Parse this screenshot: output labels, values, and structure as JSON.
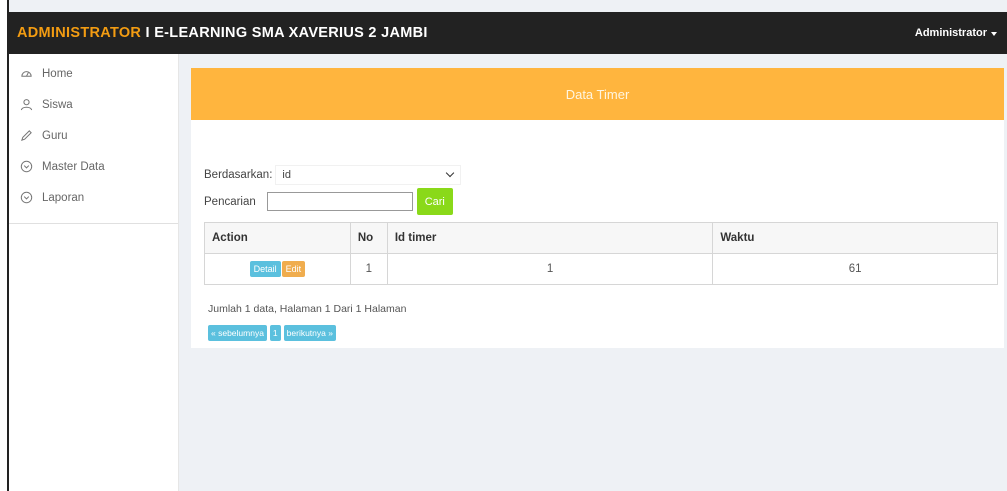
{
  "topbar": {
    "brand_part1": "ADMINISTRATOR",
    "brand_part2": " I E-LEARNING SMA XAVERIUS 2 JAMBI",
    "user_label": "Administrator"
  },
  "sidebar": {
    "items": [
      {
        "label": "Home",
        "icon": "dashboard-icon"
      },
      {
        "label": "Siswa",
        "icon": "user-icon"
      },
      {
        "label": "Guru",
        "icon": "pencil-icon"
      },
      {
        "label": "Master Data",
        "icon": "circle-chevron-down-icon"
      },
      {
        "label": "Laporan",
        "icon": "circle-chevron-down-icon"
      }
    ]
  },
  "panel": {
    "title": "Data Timer"
  },
  "filter": {
    "by_label": "Berdasarkan:",
    "by_value": "id",
    "search_label": "Pencarian",
    "search_value": "",
    "search_button": "Cari"
  },
  "table": {
    "headers": [
      "Action",
      "No",
      "Id timer",
      "Waktu"
    ],
    "rows": [
      {
        "detail": "Detail",
        "edit": "Edit",
        "no": "1",
        "id_timer": "1",
        "waktu": "61"
      }
    ]
  },
  "summary": "Jumlah 1 data, Halaman 1 Dari 1 Halaman",
  "pager": {
    "prev": "« sebelumnya",
    "page": "1",
    "next": "berikutnya »"
  },
  "colors": {
    "topbar_bg": "#222222",
    "brand_accent": "#f39c12",
    "panel_header": "#ffb53e",
    "cari_button": "#8ad919",
    "info_button": "#5bc0de",
    "edit_button": "#f0ad4e"
  }
}
